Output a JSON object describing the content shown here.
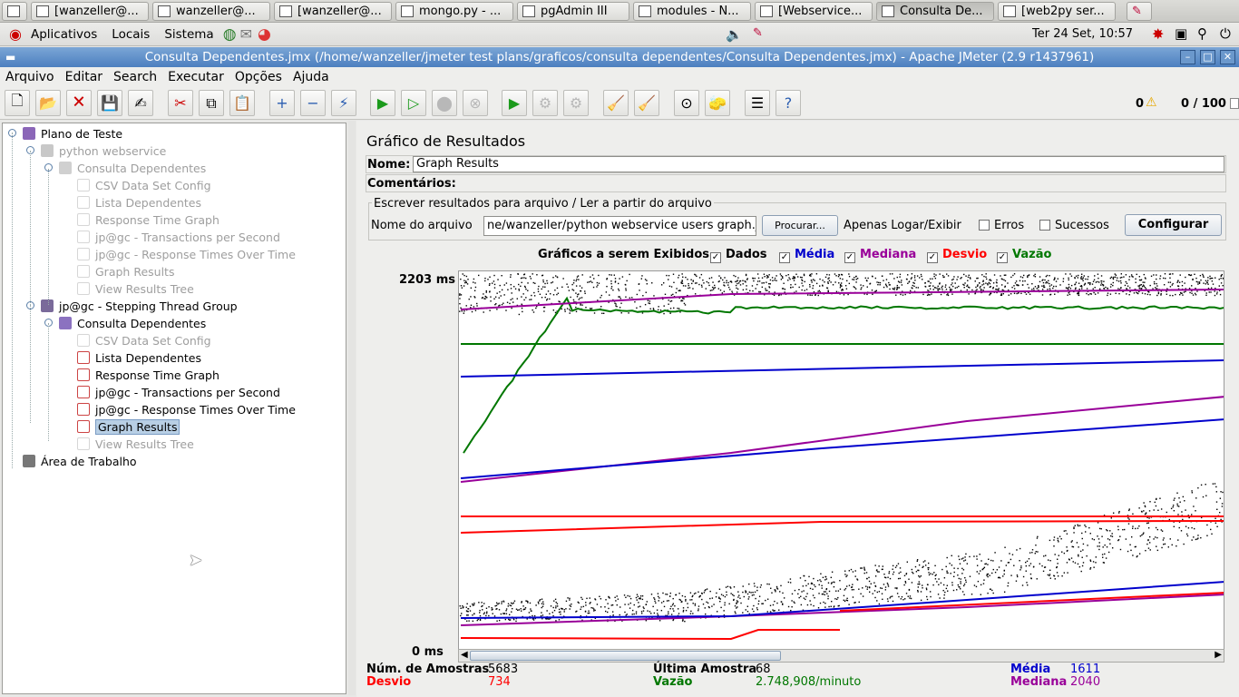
{
  "taskbar": {
    "tasks": [
      "[wanzeller@...",
      "wanzeller@...",
      "[wanzeller@...",
      "mongo.py - ...",
      "pgAdmin III",
      "modules - N...",
      "[Webservice...",
      "Consulta De...",
      "[web2py ser..."
    ]
  },
  "desktop_menu": {
    "items": [
      "Aplicativos",
      "Locais",
      "Sistema"
    ],
    "clock": "Ter 24 Set, 10:57"
  },
  "window": {
    "title": "Consulta Dependentes.jmx (/home/wanzeller/jmeter test plans/graficos/consulta dependentes/Consulta Dependentes.jmx) - Apache JMeter (2.9 r1437961)"
  },
  "menu": [
    "Arquivo",
    "Editar",
    "Search",
    "Executar",
    "Opções",
    "Ajuda"
  ],
  "toolbar": {
    "warnings": "0",
    "threads": "0 / 100"
  },
  "tree": [
    {
      "label": "Plano de Teste",
      "depth": 0,
      "disabled": false,
      "selected": false
    },
    {
      "label": "python webservice",
      "depth": 1,
      "disabled": true,
      "selected": false
    },
    {
      "label": "Consulta Dependentes",
      "depth": 2,
      "disabled": true,
      "selected": false
    },
    {
      "label": "CSV Data Set Config",
      "depth": 3,
      "disabled": true,
      "selected": false
    },
    {
      "label": "Lista Dependentes",
      "depth": 3,
      "disabled": true,
      "selected": false
    },
    {
      "label": "Response Time Graph",
      "depth": 3,
      "disabled": true,
      "selected": false
    },
    {
      "label": "jp@gc - Transactions per Second",
      "depth": 3,
      "disabled": true,
      "selected": false
    },
    {
      "label": "jp@gc - Response Times Over Time",
      "depth": 3,
      "disabled": true,
      "selected": false
    },
    {
      "label": "Graph Results",
      "depth": 3,
      "disabled": true,
      "selected": false
    },
    {
      "label": "View Results Tree",
      "depth": 3,
      "disabled": true,
      "selected": false
    },
    {
      "label": "jp@gc - Stepping Thread Group",
      "depth": 1,
      "disabled": false,
      "selected": false
    },
    {
      "label": "Consulta Dependentes",
      "depth": 2,
      "disabled": false,
      "selected": false
    },
    {
      "label": "CSV Data Set Config",
      "depth": 3,
      "disabled": true,
      "selected": false
    },
    {
      "label": "Lista Dependentes",
      "depth": 3,
      "disabled": false,
      "selected": false
    },
    {
      "label": "Response Time Graph",
      "depth": 3,
      "disabled": false,
      "selected": false
    },
    {
      "label": "jp@gc - Transactions per Second",
      "depth": 3,
      "disabled": false,
      "selected": false
    },
    {
      "label": "jp@gc - Response Times Over Time",
      "depth": 3,
      "disabled": false,
      "selected": false
    },
    {
      "label": "Graph Results",
      "depth": 3,
      "disabled": false,
      "selected": true
    },
    {
      "label": "View Results Tree",
      "depth": 3,
      "disabled": true,
      "selected": false
    },
    {
      "label": "Área de Trabalho",
      "depth": 0,
      "disabled": false,
      "selected": false
    }
  ],
  "panel": {
    "title": "Gráfico de Resultados",
    "name_label": "Nome:",
    "name_value": "Graph Results",
    "comments_label": "Comentários:",
    "file_group_title": "Escrever resultados para arquivo / Ler a partir do arquivo",
    "filename_label": "Nome do arquivo",
    "filename_value": "ne/wanzeller/python webservice users graph.jmx",
    "browse_button": "Procurar...",
    "log_only_label": "Apenas Logar/Exibir",
    "errors_label": "Erros",
    "success_label": "Sucessos",
    "configure_button": "Configurar",
    "graphs_label": "Gráficos a serem Exibidos",
    "legend": [
      {
        "label": "Dados",
        "color": "#000000",
        "checked": true
      },
      {
        "label": "Média",
        "color": "#0000cc",
        "checked": true
      },
      {
        "label": "Mediana",
        "color": "#990099",
        "checked": true
      },
      {
        "label": "Desvio",
        "color": "#ff0000",
        "checked": true
      },
      {
        "label": "Vazão",
        "color": "#007700",
        "checked": true
      }
    ],
    "y_max_label": "2203 ms",
    "y_min_label": "0 ms"
  },
  "stats": {
    "samples_label": "Núm. de Amostras",
    "samples_value": "5683",
    "last_label": "Última Amostra",
    "last_value": "68",
    "avg_label": "Média",
    "avg_value": "1611",
    "dev_label": "Desvio",
    "dev_value": "734",
    "throughput_label": "Vazão",
    "throughput_value": "2.748,908/minuto",
    "median_label": "Mediana",
    "median_value": "2040"
  },
  "chart_data": {
    "type": "scatter",
    "ylim": [
      0,
      2203
    ],
    "series": [
      {
        "name": "Dados",
        "color": "#000000"
      },
      {
        "name": "Média",
        "color": "#0000cc"
      },
      {
        "name": "Mediana",
        "color": "#990099"
      },
      {
        "name": "Desvio",
        "color": "#ff0000"
      },
      {
        "name": "Vazão",
        "color": "#007700"
      }
    ]
  }
}
